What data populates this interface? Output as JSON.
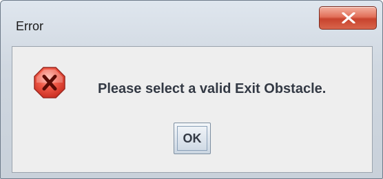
{
  "window": {
    "title": "Error"
  },
  "titlebar": {
    "close_icon": "close-x-icon",
    "close_color": "#d8654c"
  },
  "dialog": {
    "icon": "error-x-octagon-icon",
    "icon_color": "#e23a2b",
    "message": "Please select a valid Exit Obstacle.",
    "ok_label": "OK"
  }
}
